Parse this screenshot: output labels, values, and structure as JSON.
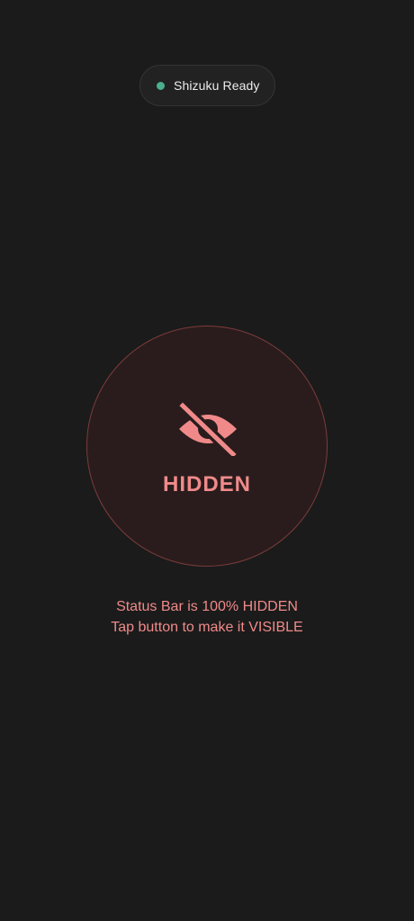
{
  "service_status": {
    "label": "Shizuku Ready",
    "dot_color": "#4caf8c"
  },
  "toggle": {
    "state_label": "HIDDEN",
    "icon": "eye-off-icon",
    "accent_color": "#f08a8a"
  },
  "message": {
    "line1": "Status Bar is 100% HIDDEN",
    "line2": "Tap button to make it VISIBLE"
  }
}
